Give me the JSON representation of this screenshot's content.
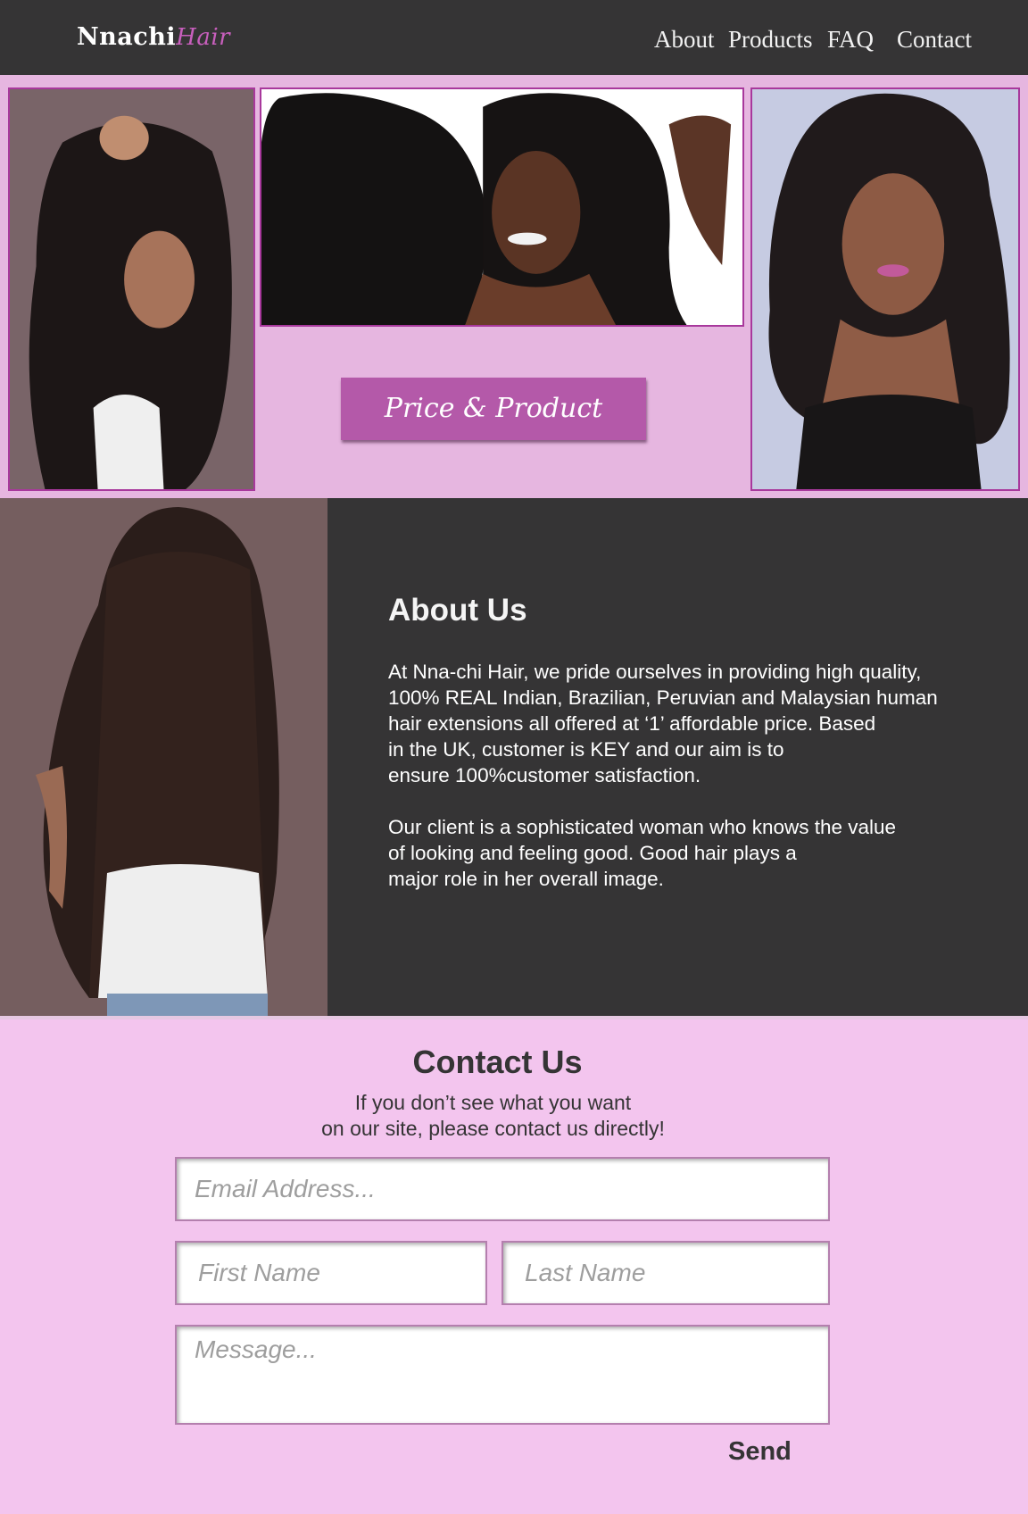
{
  "header": {
    "logo_main": "Nnachi",
    "logo_accent": "Hair",
    "nav": [
      "About",
      "Products",
      "FAQ",
      "Contact"
    ]
  },
  "hero": {
    "cta_label": "Price & Product"
  },
  "about": {
    "title": "About Us",
    "paragraph1": "At Nna-chi Hair, we pride ourselves in providing high quality,\n100% REAL Indian, Brazilian, Peruvian and Malaysian human\nhair extensions all offered at ‘1’ affordable price. Based\nin the UK, customer is KEY and our aim is to\nensure 100%customer satisfaction.",
    "paragraph2": "Our client is a sophisticated woman who knows the value\nof looking and feeling good. Good hair plays a\nmajor role in her overall image."
  },
  "contact": {
    "title": "Contact Us",
    "subtitle": "If you don’t see what you want\non our site, please contact us directly!",
    "email_placeholder": "Email Address...",
    "first_name_placeholder": "First Name",
    "last_name_placeholder": "Last Name",
    "message_placeholder": "Message...",
    "send_label": "Send"
  },
  "colors": {
    "header_bg": "#353435",
    "accent": "#b459a9",
    "hero_bg": "#e6b6e0",
    "contact_bg": "#f3c5ee"
  }
}
